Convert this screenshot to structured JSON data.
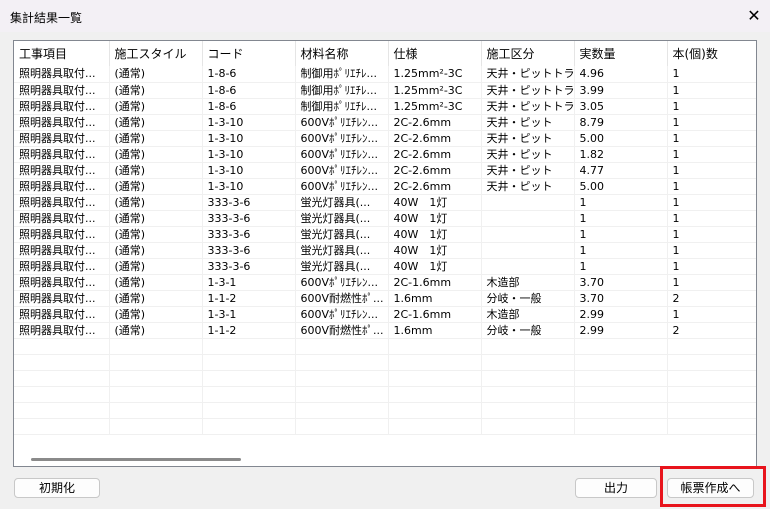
{
  "window": {
    "title": "集計結果一覧",
    "close_icon": "close-icon"
  },
  "table": {
    "columns": [
      "工事項目",
      "施工スタイル",
      "コード",
      "材料名称",
      "仕様",
      "施工区分",
      "実数量",
      "本(個)数"
    ],
    "rows": [
      [
        "照明器具取付...",
        "(通常)",
        "1-8-6",
        "制御用ﾎﾟﾘｴﾁﾚ...",
        "1.25mm²-3C",
        "天井・ピットトラ...",
        "4.96",
        "1"
      ],
      [
        "照明器具取付...",
        "(通常)",
        "1-8-6",
        "制御用ﾎﾟﾘｴﾁﾚ...",
        "1.25mm²-3C",
        "天井・ピットトラ...",
        "3.99",
        "1"
      ],
      [
        "照明器具取付...",
        "(通常)",
        "1-8-6",
        "制御用ﾎﾟﾘｴﾁﾚ...",
        "1.25mm²-3C",
        "天井・ピットトラ...",
        "3.05",
        "1"
      ],
      [
        "照明器具取付...",
        "(通常)",
        "1-3-10",
        "600Vﾎﾟﾘｴﾁﾚﾝ...",
        "2C-2.6mm",
        "天井・ピット",
        "8.79",
        "1"
      ],
      [
        "照明器具取付...",
        "(通常)",
        "1-3-10",
        "600Vﾎﾟﾘｴﾁﾚﾝ...",
        "2C-2.6mm",
        "天井・ピット",
        "5.00",
        "1"
      ],
      [
        "照明器具取付...",
        "(通常)",
        "1-3-10",
        "600Vﾎﾟﾘｴﾁﾚﾝ...",
        "2C-2.6mm",
        "天井・ピット",
        "1.82",
        "1"
      ],
      [
        "照明器具取付...",
        "(通常)",
        "1-3-10",
        "600Vﾎﾟﾘｴﾁﾚﾝ...",
        "2C-2.6mm",
        "天井・ピット",
        "4.77",
        "1"
      ],
      [
        "照明器具取付...",
        "(通常)",
        "1-3-10",
        "600Vﾎﾟﾘｴﾁﾚﾝ...",
        "2C-2.6mm",
        "天井・ピット",
        "5.00",
        "1"
      ],
      [
        "照明器具取付...",
        "(通常)",
        "333-3-6",
        "蛍光灯器具(...",
        "40W　1灯",
        "",
        "1",
        "1"
      ],
      [
        "照明器具取付...",
        "(通常)",
        "333-3-6",
        "蛍光灯器具(...",
        "40W　1灯",
        "",
        "1",
        "1"
      ],
      [
        "照明器具取付...",
        "(通常)",
        "333-3-6",
        "蛍光灯器具(...",
        "40W　1灯",
        "",
        "1",
        "1"
      ],
      [
        "照明器具取付...",
        "(通常)",
        "333-3-6",
        "蛍光灯器具(...",
        "40W　1灯",
        "",
        "1",
        "1"
      ],
      [
        "照明器具取付...",
        "(通常)",
        "333-3-6",
        "蛍光灯器具(...",
        "40W　1灯",
        "",
        "1",
        "1"
      ],
      [
        "照明器具取付...",
        "(通常)",
        "1-3-1",
        "600Vﾎﾟﾘｴﾁﾚﾝ...",
        "2C-1.6mm",
        "木造部",
        "3.70",
        "1"
      ],
      [
        "照明器具取付...",
        "(通常)",
        "1-1-2",
        "600V耐燃性ﾎﾟ...",
        "1.6mm",
        "分岐・一般",
        "3.70",
        "2"
      ],
      [
        "照明器具取付...",
        "(通常)",
        "1-3-1",
        "600Vﾎﾟﾘｴﾁﾚﾝ...",
        "2C-1.6mm",
        "木造部",
        "2.99",
        "1"
      ],
      [
        "照明器具取付...",
        "(通常)",
        "1-1-2",
        "600V耐燃性ﾎﾟ...",
        "1.6mm",
        "分岐・一般",
        "2.99",
        "2"
      ]
    ]
  },
  "buttons": {
    "reset": "初期化",
    "output": "出力",
    "report": "帳票作成へ"
  },
  "colors": {
    "highlight": "#e8141c"
  }
}
